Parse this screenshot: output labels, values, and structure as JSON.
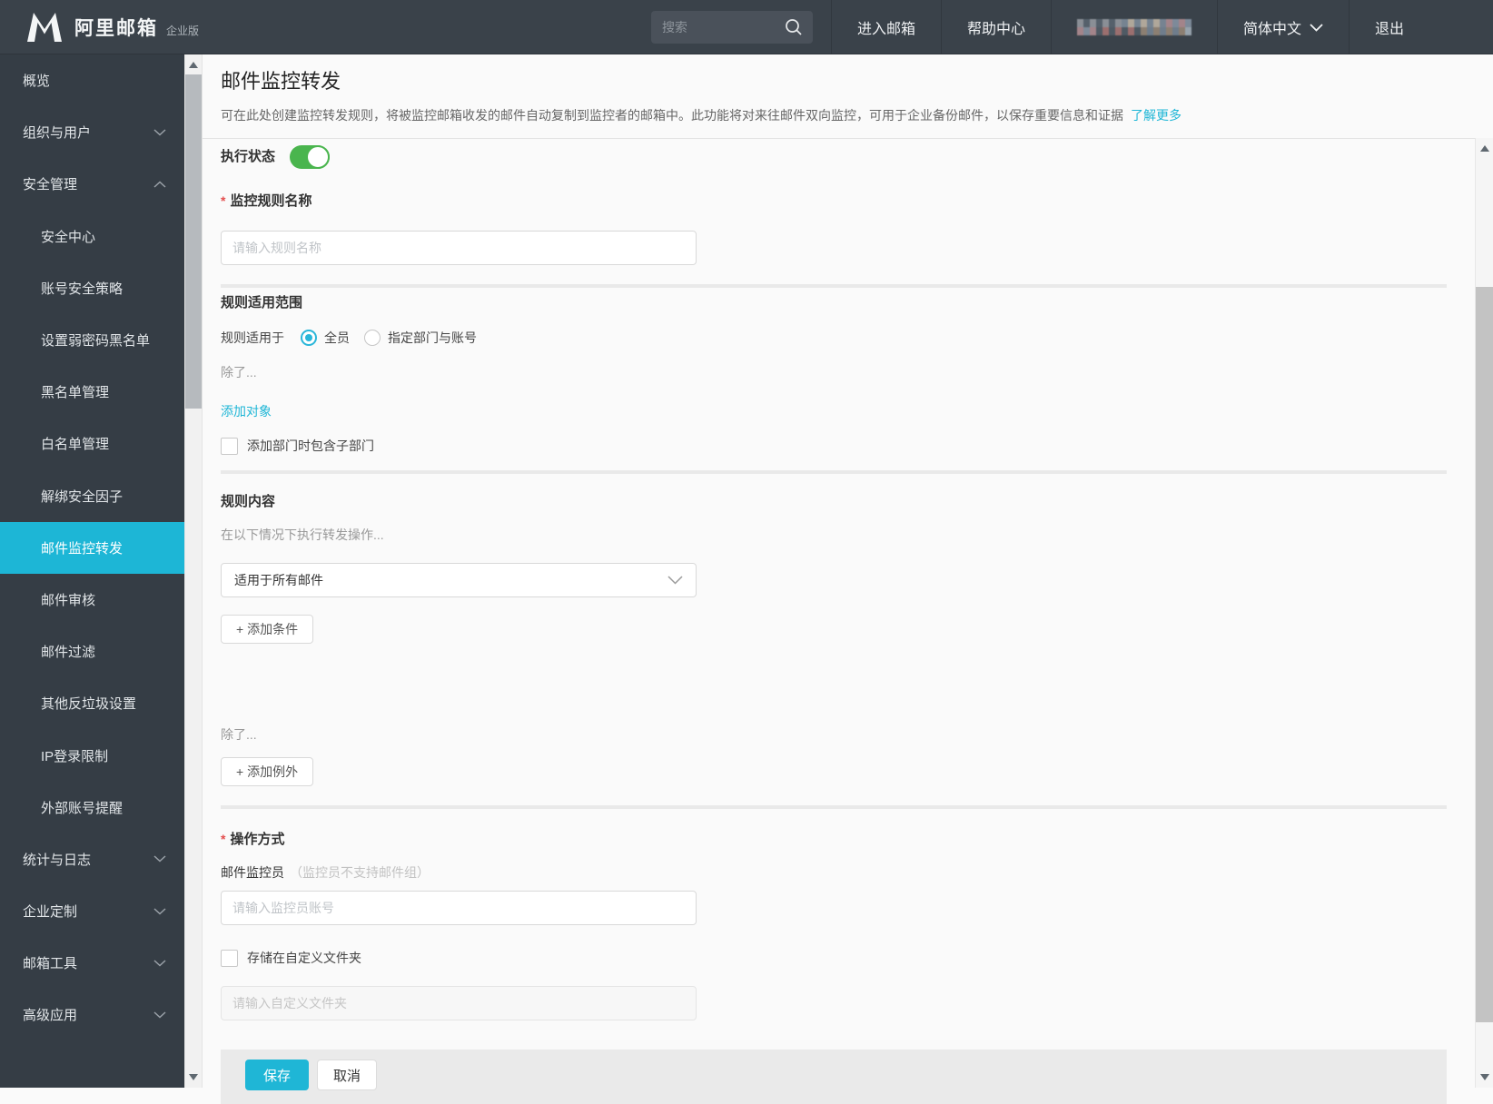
{
  "topbar": {
    "brand": "阿里邮箱",
    "edition": "企业版",
    "search_placeholder": "搜索",
    "nav": [
      "进入邮箱",
      "帮助中心"
    ],
    "language": "简体中文",
    "logout": "退出"
  },
  "sidebar": {
    "items": [
      {
        "label": "概览",
        "sub": false,
        "chevron": "",
        "active": false
      },
      {
        "label": "组织与用户",
        "sub": false,
        "chevron": "down",
        "active": false
      },
      {
        "label": "安全管理",
        "sub": false,
        "chevron": "up",
        "active": false
      },
      {
        "label": "安全中心",
        "sub": true,
        "chevron": "",
        "active": false
      },
      {
        "label": "账号安全策略",
        "sub": true,
        "chevron": "",
        "active": false
      },
      {
        "label": "设置弱密码黑名单",
        "sub": true,
        "chevron": "",
        "active": false
      },
      {
        "label": "黑名单管理",
        "sub": true,
        "chevron": "",
        "active": false
      },
      {
        "label": "白名单管理",
        "sub": true,
        "chevron": "",
        "active": false
      },
      {
        "label": "解绑安全因子",
        "sub": true,
        "chevron": "",
        "active": false
      },
      {
        "label": "邮件监控转发",
        "sub": true,
        "chevron": "",
        "active": true
      },
      {
        "label": "邮件审核",
        "sub": true,
        "chevron": "",
        "active": false
      },
      {
        "label": "邮件过滤",
        "sub": true,
        "chevron": "",
        "active": false
      },
      {
        "label": "其他反垃圾设置",
        "sub": true,
        "chevron": "",
        "active": false
      },
      {
        "label": "IP登录限制",
        "sub": true,
        "chevron": "",
        "active": false
      },
      {
        "label": "外部账号提醒",
        "sub": true,
        "chevron": "",
        "active": false
      },
      {
        "label": "统计与日志",
        "sub": false,
        "chevron": "down",
        "active": false
      },
      {
        "label": "企业定制",
        "sub": false,
        "chevron": "down",
        "active": false
      },
      {
        "label": "邮箱工具",
        "sub": false,
        "chevron": "down",
        "active": false
      },
      {
        "label": "高级应用",
        "sub": false,
        "chevron": "down",
        "active": false
      }
    ]
  },
  "page": {
    "title": "邮件监控转发",
    "description": "可在此处创建监控转发规则，将被监控邮箱收发的邮件自动复制到监控者的邮箱中。此功能将对来往邮件双向监控，可用于企业备份邮件，以保存重要信息和证据",
    "learn_more": "了解更多"
  },
  "form": {
    "exec_status_label": "执行状态",
    "exec_status_on": true,
    "rule_name_label": "监控规则名称",
    "rule_name_placeholder": "请输入规则名称",
    "scope_section_title": "规则适用范围",
    "scope_label": "规则适用于",
    "scope_options": [
      {
        "label": "全员",
        "selected": true
      },
      {
        "label": "指定部门与账号",
        "selected": false
      }
    ],
    "except_label": "除了...",
    "add_target_link": "添加对象",
    "include_sub_dept_label": "添加部门时包含子部门",
    "content_section_title": "规则内容",
    "condition_hint": "在以下情况下执行转发操作...",
    "condition_select_value": "适用于所有邮件",
    "add_condition_button": "+ 添加条件",
    "except_label2": "除了...",
    "add_exception_button": "+ 添加例外",
    "action_section_title": "操作方式",
    "monitor_label": "邮件监控员",
    "monitor_note": "（监控员不支持邮件组）",
    "monitor_placeholder": "请输入监控员账号",
    "custom_folder_label": "存储在自定义文件夹",
    "custom_folder_placeholder": "请输入自定义文件夹",
    "save_button": "保存",
    "cancel_button": "取消"
  },
  "colors": {
    "accent": "#1fb6d6",
    "toggle_on": "#4ab54e",
    "sidebar_active_bg": "#1db6d6"
  }
}
